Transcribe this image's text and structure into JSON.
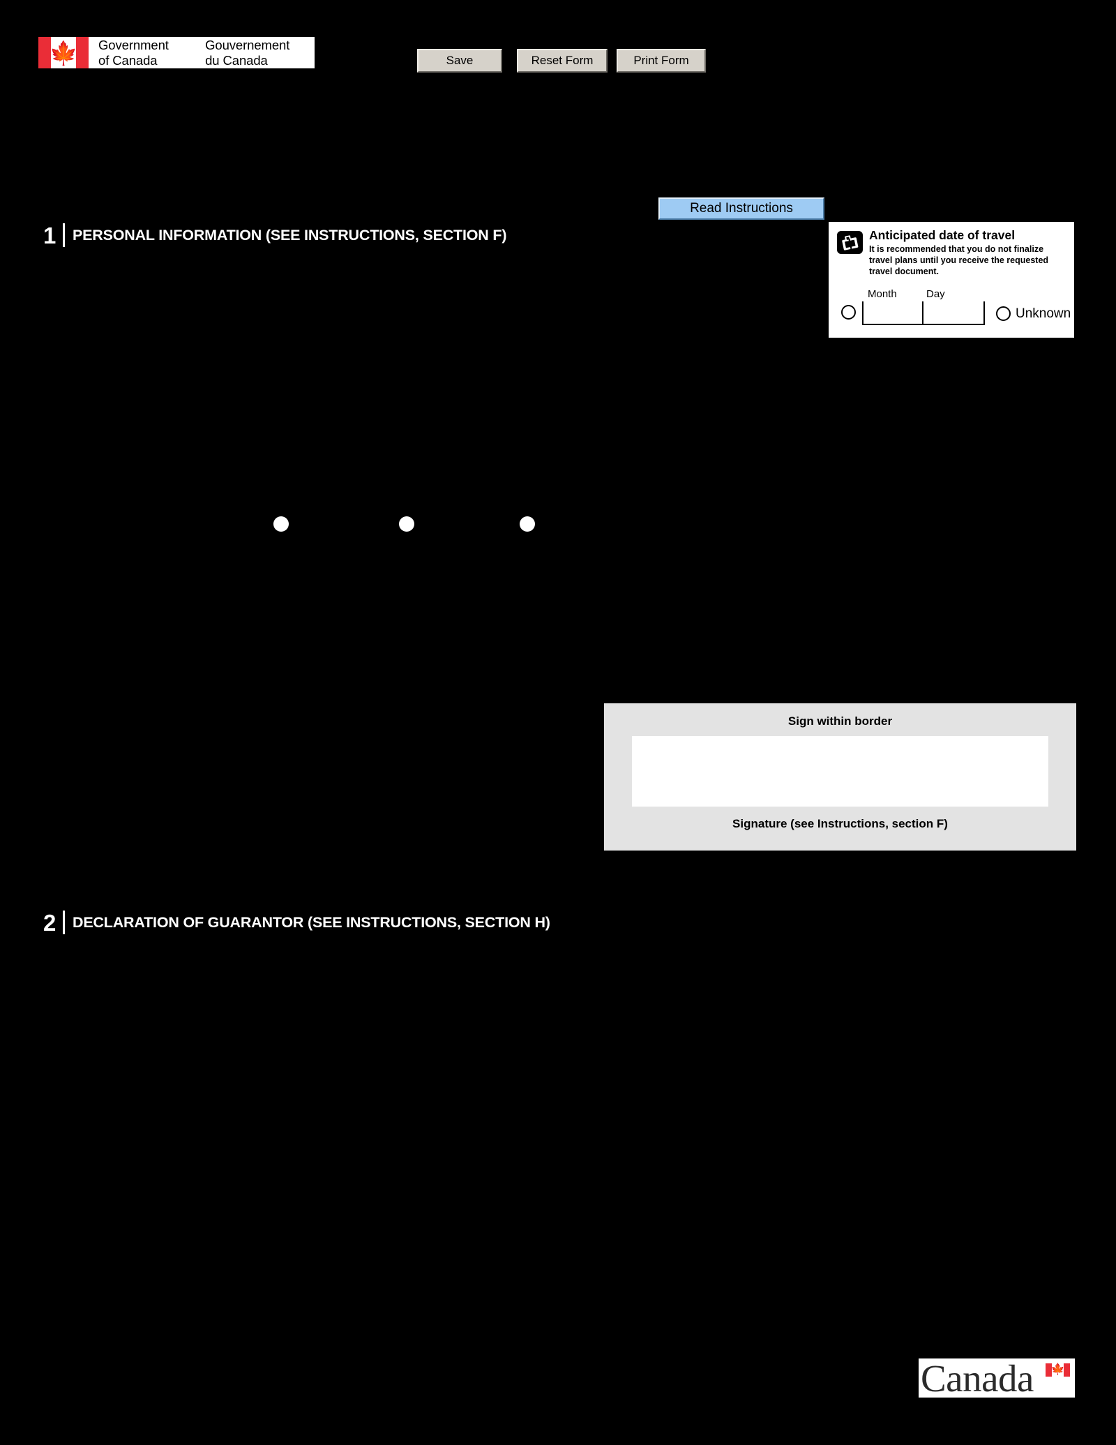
{
  "header": {
    "wordmark": {
      "english": "Government\nof Canada",
      "french": "Gouvernement\ndu Canada"
    },
    "buttons": {
      "save": "Save",
      "reset": "Reset Form",
      "print": "Print Form"
    }
  },
  "read_instructions": {
    "label": "Read Instructions",
    "background_color": "#9ecbf3"
  },
  "sections": [
    {
      "number": "1",
      "title": "PERSONAL INFORMATION (SEE INSTRUCTIONS, SECTION F)"
    },
    {
      "number": "2",
      "title": "DECLARATION OF GUARANTOR (SEE INSTRUCTIONS, SECTION H)"
    }
  ],
  "travel": {
    "title": "Anticipated date of travel",
    "note": "It is recommended that you do not finalize travel plans until you receive the requested travel document.",
    "month_label": "Month",
    "day_label": "Day",
    "month_value": "",
    "day_value": "",
    "unknown_label": "Unknown"
  },
  "signature": {
    "sign_within_border": "Sign within border",
    "caption": "Signature (see Instructions, section F)",
    "value": "",
    "background_color": "#e3e3e3"
  },
  "footer": {
    "canada_wordmark": "Canada"
  },
  "colors": {
    "page_background": "#000000",
    "heading_text": "#ffffff",
    "flag_red": "#ea2d37",
    "button_face": "#d6d2ca"
  }
}
